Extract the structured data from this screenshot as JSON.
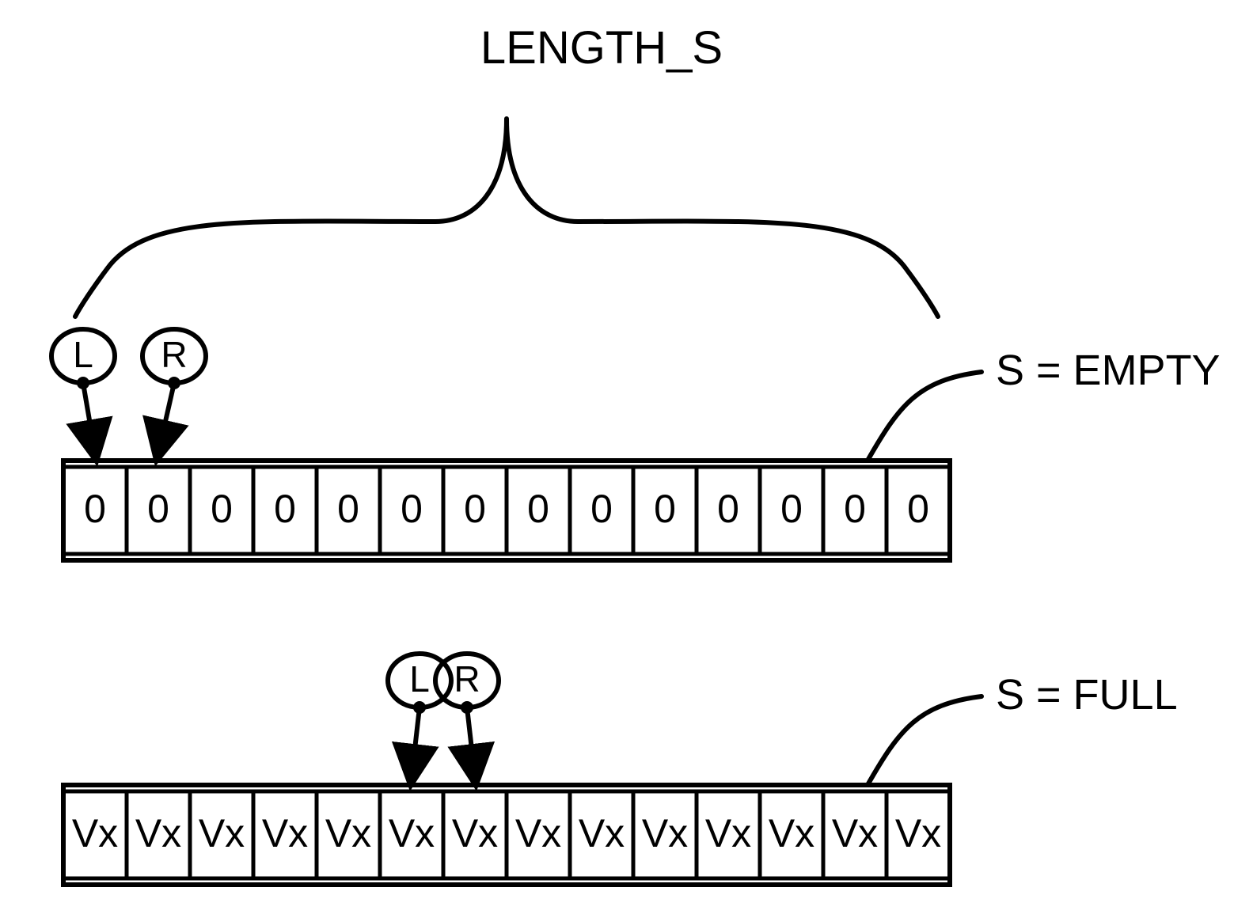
{
  "title": "LENGTH_S",
  "pointer_label_L": "L",
  "pointer_label_R": "R",
  "empty_state_label": "S = EMPTY",
  "full_state_label": "S = FULL",
  "num_cells": 14,
  "empty_array": [
    "0",
    "0",
    "0",
    "0",
    "0",
    "0",
    "0",
    "0",
    "0",
    "0",
    "0",
    "0",
    "0",
    "0"
  ],
  "full_array": [
    "Vx",
    "Vx",
    "Vx",
    "Vx",
    "Vx",
    "Vx",
    "Vx",
    "Vx",
    "Vx",
    "Vx",
    "Vx",
    "Vx",
    "Vx",
    "Vx"
  ],
  "empty_pointer_L_index": 0,
  "empty_pointer_R_index": 1,
  "full_pointer_L_index": 5,
  "full_pointer_R_index": 6
}
